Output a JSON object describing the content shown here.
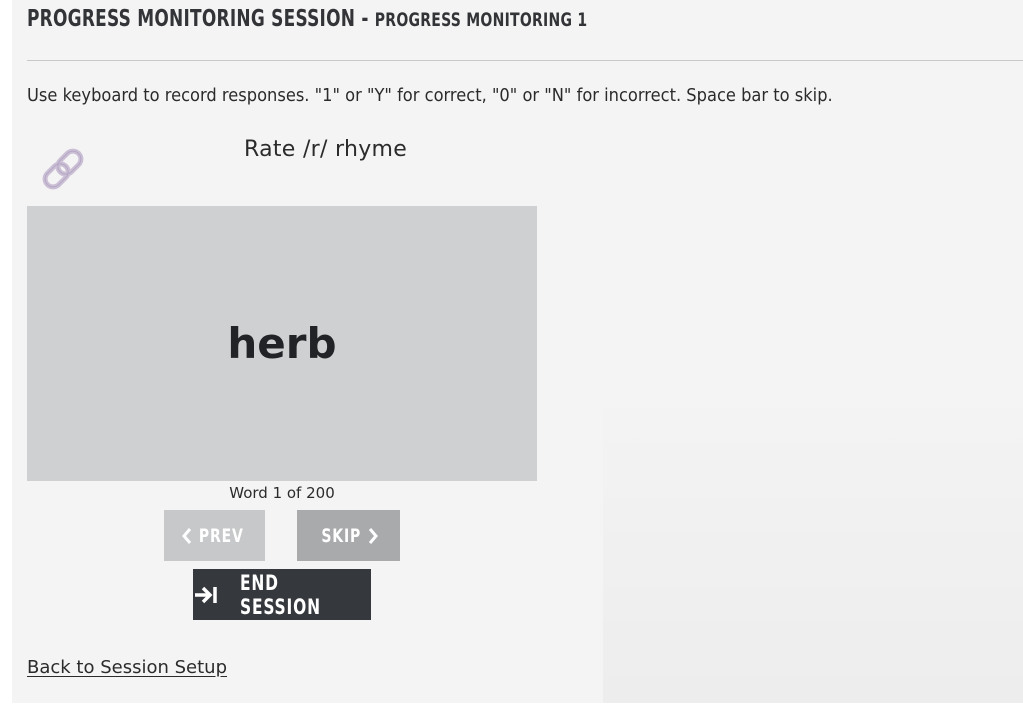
{
  "header": {
    "title": "PROGRESS MONITORING SESSION",
    "separator": " - ",
    "subtitle": "PROGRESS MONITORING 1"
  },
  "instructions": "Use keyboard to record responses. \"1\" or \"Y\" for correct, \"0\" or \"N\" for incorrect. Space bar to skip.",
  "task": {
    "label": "Rate /r/ rhyme",
    "icon": "chain-link-icon"
  },
  "card": {
    "word": "herb",
    "counter": "Word 1 of 200"
  },
  "buttons": {
    "prev_label": "PREV",
    "skip_label": "SKIP",
    "end_label": "END SESSION"
  },
  "footer": {
    "back_link": "Back to Session Setup"
  },
  "colors": {
    "panel_bg": "#f4f4f4",
    "card_bg": "#cfd0d2",
    "prev_bg": "#c7c8ca",
    "skip_bg": "#a9aaac",
    "end_bg": "#35383d",
    "link_icon": "#cbbfd6"
  }
}
